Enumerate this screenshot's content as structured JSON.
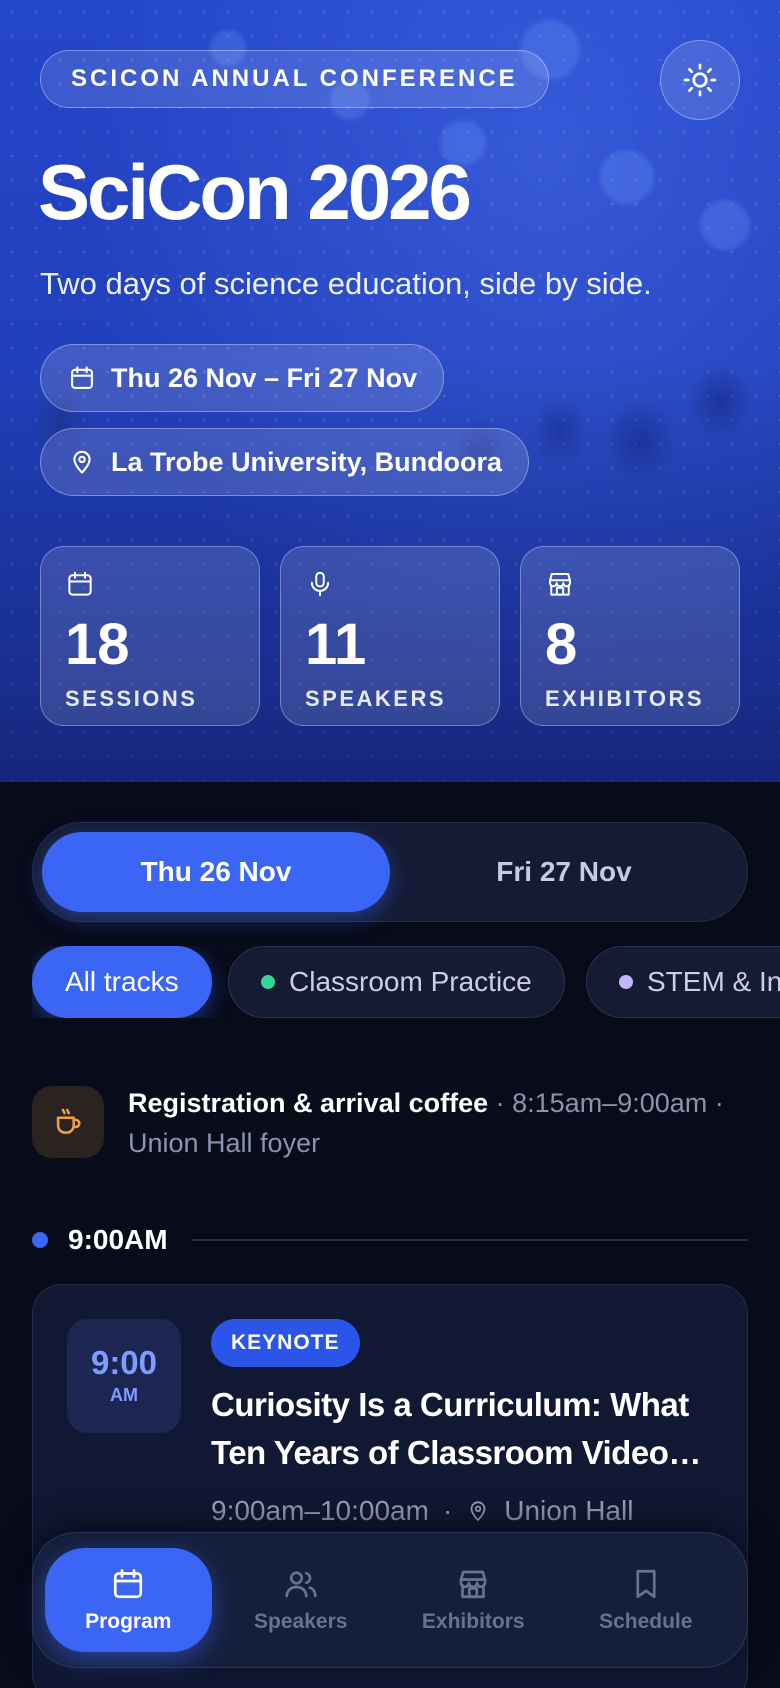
{
  "hero": {
    "eyebrow": "SCICON ANNUAL CONFERENCE",
    "title": "SciCon 2026",
    "subtitle": "Two days of science education, side by side.",
    "dates": "Thu 26 Nov – Fri 27 Nov",
    "venue": "La Trobe University, Bundoora",
    "stats": [
      {
        "value": "18",
        "label": "SESSIONS",
        "icon": "calendar-icon"
      },
      {
        "value": "11",
        "label": "SPEAKERS",
        "icon": "microphone-icon"
      },
      {
        "value": "8",
        "label": "EXHIBITORS",
        "icon": "storefront-icon"
      }
    ]
  },
  "days": [
    {
      "label": "Thu 26 Nov",
      "active": true
    },
    {
      "label": "Fri 27 Nov",
      "active": false
    }
  ],
  "tracks": [
    {
      "label": "All tracks",
      "active": true
    },
    {
      "label": "Classroom Practice",
      "color": "#34d399"
    },
    {
      "label": "STEM & Inn",
      "color": "#c4b5fd"
    }
  ],
  "break_item": {
    "title": "Registration & arrival coffee",
    "sep1": " · ",
    "time": "8:15am–9:00am",
    "sep2": " ·",
    "location": "Union Hall foyer",
    "icon": "coffee-icon"
  },
  "time_slot": {
    "label": "9:00AM"
  },
  "session": {
    "start_hour": "9:00",
    "start_ampm": "AM",
    "badge": "KEYNOTE",
    "title": "Curiosity Is a Curriculum: What Ten Years of Classroom Video Taught Us",
    "time_range": "9:00am–10:00am",
    "dot": "·",
    "location": "Union Hall"
  },
  "nav": [
    {
      "label": "Program",
      "active": true,
      "icon": "calendar-icon"
    },
    {
      "label": "Speakers",
      "icon": "people-icon"
    },
    {
      "label": "Exhibitors",
      "icon": "storefront-icon"
    },
    {
      "label": "Schedule",
      "icon": "bookmark-icon"
    }
  ],
  "colors": {
    "accent": "#3b66f5",
    "hero_blue": "#2446c9",
    "background": "#070b1a",
    "keynote_badge": "#2a55e8",
    "coffee": "#f2a03d"
  }
}
